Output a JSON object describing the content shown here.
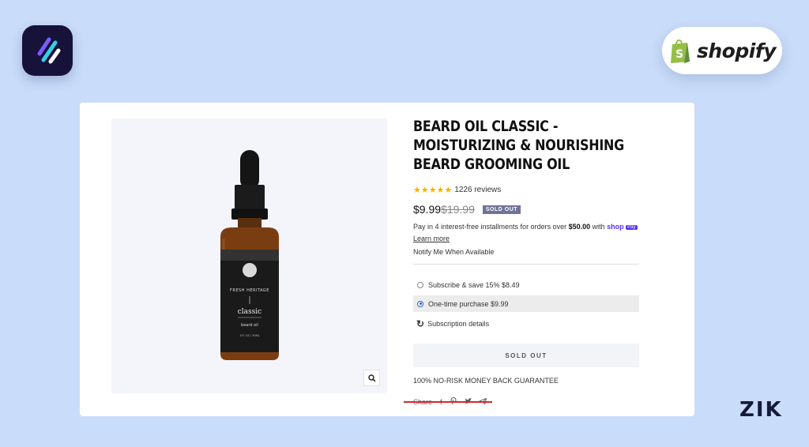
{
  "brand": {
    "shopify_label": "shopify",
    "watermark": "ZIK",
    "colors": {
      "background": "#c9dcf9",
      "shopify_green": "#95bf47",
      "sold_badge": "#6f7396",
      "highlight": "#d8272c"
    }
  },
  "product": {
    "title": "BEARD OIL CLASSIC - MOISTURIZING & NOURISHING BEARD GROOMING OIL",
    "rating": {
      "stars": 5,
      "reviews_label": "1226 reviews"
    },
    "price": "$9.99",
    "compare_price": "$19.99",
    "sold_badge": "SOLD OUT",
    "installments": {
      "prefix": "Pay in 4 interest-free installments for orders over ",
      "amount": "$50.00",
      "middle": " with ",
      "shop_label": "shop",
      "pay_label": "Pay"
    },
    "learn_more": "Learn more",
    "notify": "Notify Me When Available",
    "options": [
      {
        "label": "Subscribe & save 15% $8.49",
        "selected": false
      },
      {
        "label": "One-time purchase $9.99",
        "selected": true
      }
    ],
    "subscription_details": "Subscription details",
    "sold_out_button": "SOLD OUT",
    "guarantee": "100% NO-RISK MONEY BACK GUARANTEE",
    "share_label": "Share",
    "share_icons": [
      "facebook-icon",
      "pinterest-icon",
      "twitter-icon",
      "telegram-icon"
    ]
  },
  "bottle_label": {
    "brand": "FRESH HERITAGE",
    "name": "classic",
    "type": "beard oil",
    "volume": "1FL OZ / 30ML"
  }
}
